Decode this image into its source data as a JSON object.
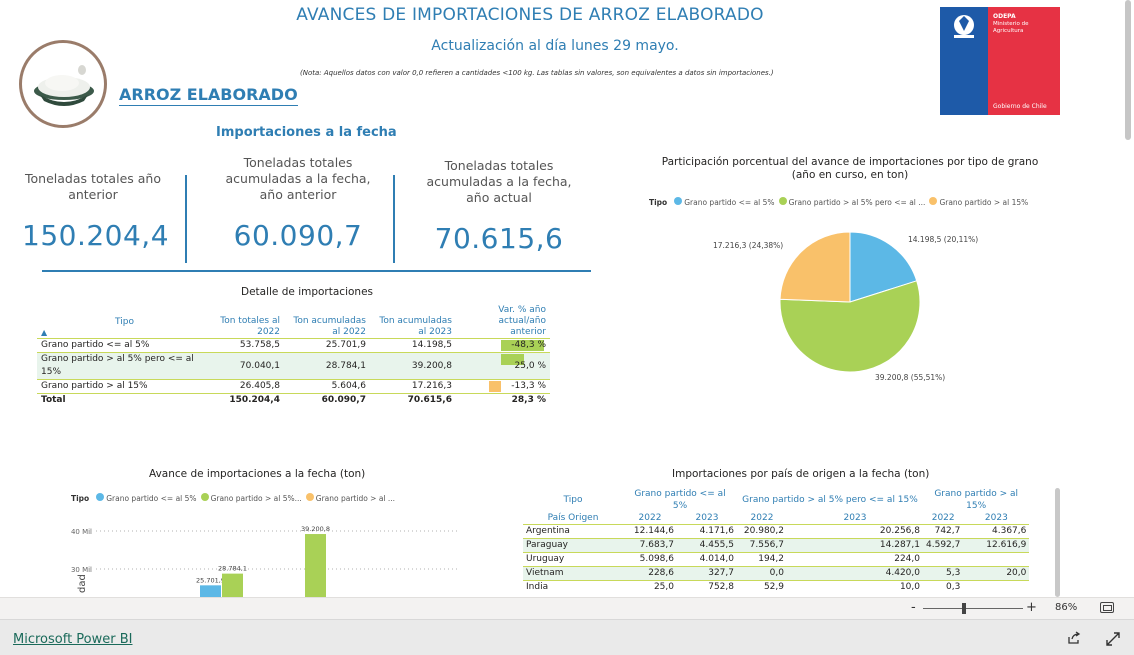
{
  "header": {
    "title": "AVANCES DE IMPORTACIONES DE ARROZ ELABORADO",
    "subtitle": "Actualización al día lunes 29 mayo.",
    "note": "(Nota: Aquellos datos con valor 0,0 refieren a cantidades <100 kg. Las tablas sin valores, son equivalentes a datos sin importaciones.)",
    "brand": "ARROZ ELABORADO"
  },
  "logo": {
    "org": "ODEPA",
    "ministry_line1": "Ministerio de",
    "ministry_line2": "Agricultura",
    "gov": "Gobierno de Chile"
  },
  "section_title": "Importaciones a la fecha",
  "kpis": [
    {
      "label": "Toneladas totales año anterior",
      "value": "150.204,4"
    },
    {
      "label": "Toneladas totales acumuladas a la fecha, año anterior",
      "value": "60.090,7"
    },
    {
      "label": "Toneladas totales acumuladas a la fecha, año actual",
      "value": "70.615,6"
    }
  ],
  "detail": {
    "title": "Detalle de importaciones",
    "headers": [
      "Tipo",
      "Ton totales al 2022",
      "Ton acumuladas al 2022",
      "Ton acumuladas al 2023",
      "Var. % año actual/año anterior"
    ],
    "rows": [
      {
        "tipo": "Grano partido <= al 5%",
        "t2022": "53.758,5",
        "a2022": "25.701,9",
        "a2023": "14.198,5",
        "var": "-48,3 %",
        "var_num": -48.3
      },
      {
        "tipo": "Grano partido > al 5% pero <= al 15%",
        "t2022": "70.040,1",
        "a2022": "28.784,1",
        "a2023": "39.200,8",
        "var": "25,0 %",
        "var_num": 25.0
      },
      {
        "tipo": "Grano partido > al 15%",
        "t2022": "26.405,8",
        "a2022": "5.604,6",
        "a2023": "17.216,3",
        "var": "-13,3 %",
        "var_num": -13.3
      }
    ],
    "total": {
      "tipo": "Total",
      "t2022": "150.204,4",
      "a2022": "60.090,7",
      "a2023": "70.615,6",
      "var": "28,3 %"
    }
  },
  "pie": {
    "title_line1": "Participación porcentual del avance de importaciones por tipo de grano",
    "title_line2": "(año en curso, en ton)",
    "legend_title": "Tipo",
    "legend": [
      "Grano partido <= al 5%",
      "Grano partido > al 5% pero <= al ...",
      "Grano partido > al 15%"
    ],
    "labels": [
      "14.198,5 (20,11%)",
      "39.200,8 (55,51%)",
      "17.216,3 (24,38%)"
    ],
    "colors": [
      "#5cb8e6",
      "#a9d156",
      "#f9c16a"
    ]
  },
  "chart_data": [
    {
      "type": "pie",
      "title": "Participación porcentual del avance de importaciones por tipo de grano (año en curso, en ton)",
      "categories": [
        "Grano partido <= al 5%",
        "Grano partido > al 5% pero <= al 15%",
        "Grano partido > al 15%"
      ],
      "values": [
        14198.5,
        39200.8,
        17216.3
      ],
      "percents": [
        20.11,
        55.51,
        24.38
      ],
      "legend": "top-left"
    },
    {
      "type": "bar",
      "title": "Avance de importaciones a la fecha (ton)",
      "series": [
        {
          "name": "Grano partido <= al 5%",
          "values": [
            25701.9
          ]
        },
        {
          "name": "Grano partido > al 5%...",
          "values": [
            28784.1,
            39200.8
          ]
        },
        {
          "name": "Grano partido > al ...",
          "values": []
        }
      ],
      "visible_bars": [
        {
          "series": "Grano partido <= al 5%",
          "value": 25701.9,
          "label": "25.701,9"
        },
        {
          "series": "Grano partido > al 5%...",
          "value": 28784.1,
          "label": "28.784,1"
        },
        {
          "series": "Grano partido > al 5%...",
          "value": 39200.8,
          "label": "39.200,8"
        }
      ],
      "yticks": [
        "30 Mil",
        "40 Mil"
      ],
      "ylabel_partial": "dad",
      "legend_title": "Tipo",
      "legend_items": [
        "Grano partido <= al 5%",
        "Grano partido > al 5%...",
        "Grano partido > al ..."
      ]
    }
  ],
  "countries": {
    "title": "Importaciones por país de origen a la fecha (ton)",
    "group_header": [
      "Tipo",
      "Grano partido <= al 5%",
      "Grano partido > al 5% pero <= al 15%",
      "Grano partido > al 15%"
    ],
    "sub_header": [
      "País Origen",
      "2022",
      "2023",
      "2022",
      "2023",
      "2022",
      "2023"
    ],
    "rows": [
      [
        "Argentina",
        "12.144,6",
        "4.171,6",
        "20.980,2",
        "20.256,8",
        "742,7",
        "4.367,6"
      ],
      [
        "Paraguay",
        "7.683,7",
        "4.455,5",
        "7.556,7",
        "14.287,1",
        "4.592,7",
        "12.616,9"
      ],
      [
        "Uruguay",
        "5.098,6",
        "4.014,0",
        "194,2",
        "224,0",
        "",
        ""
      ],
      [
        "Vietnam",
        "228,6",
        "327,7",
        "0,0",
        "4.420,0",
        "5,3",
        "20,0"
      ],
      [
        "India",
        "25,0",
        "752,8",
        "52,9",
        "10,0",
        "0,3",
        ""
      ]
    ]
  },
  "zoom": {
    "minus": "-",
    "plus": "+",
    "percent": "86%"
  },
  "footer": {
    "brand": "Microsoft Power BI"
  }
}
